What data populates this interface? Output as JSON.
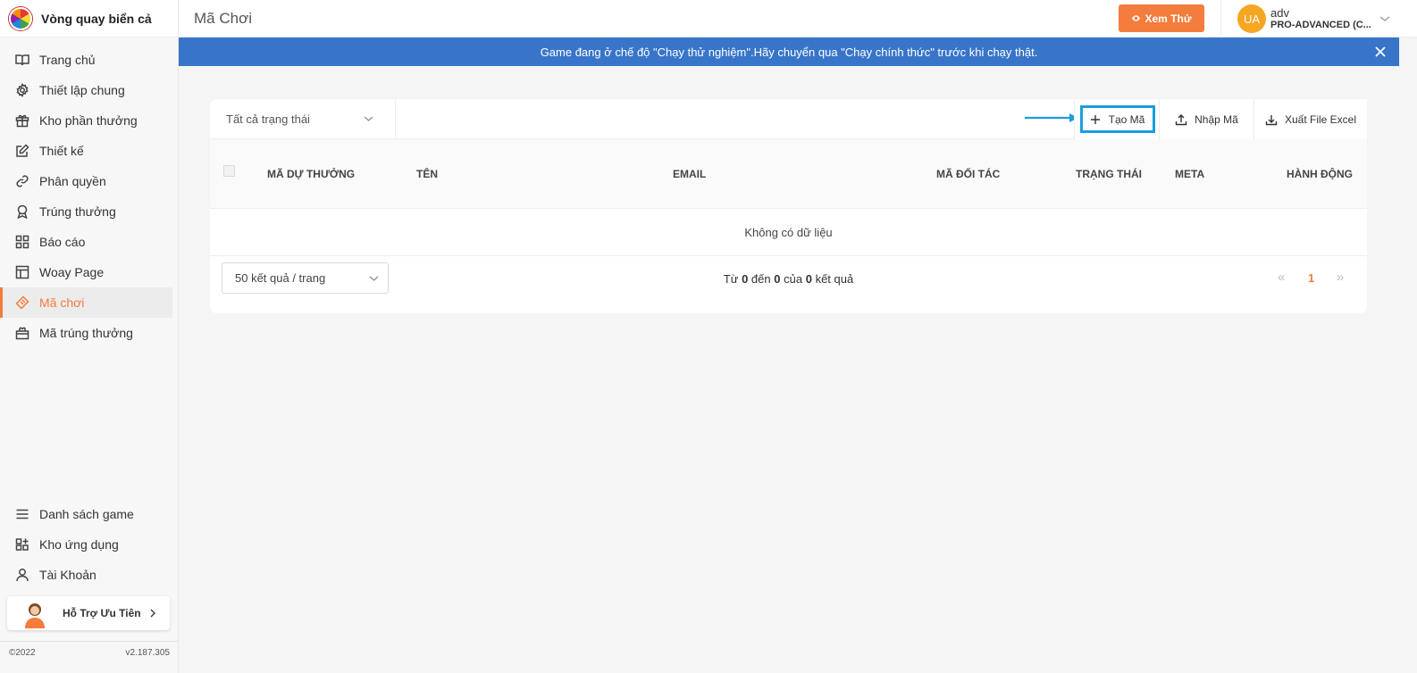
{
  "app": {
    "name": "Vòng quay biển cả",
    "copyright": "©2022",
    "version": "v2.187.305"
  },
  "sidebar": {
    "items": [
      {
        "label": "Trang chủ",
        "icon": "book-icon"
      },
      {
        "label": "Thiết lập chung",
        "icon": "gear-icon"
      },
      {
        "label": "Kho phần thưởng",
        "icon": "gift-icon"
      },
      {
        "label": "Thiết kế",
        "icon": "edit-icon"
      },
      {
        "label": "Phân quyền",
        "icon": "link-icon"
      },
      {
        "label": "Trúng thưởng",
        "icon": "award-icon"
      },
      {
        "label": "Báo cáo",
        "icon": "grid-icon"
      },
      {
        "label": "Woay Page",
        "icon": "layout-icon"
      },
      {
        "label": "Mã chơi",
        "icon": "ticket-icon",
        "active": true
      },
      {
        "label": "Mã trúng thưởng",
        "icon": "gift-box-icon"
      }
    ],
    "bottom_items": [
      {
        "label": "Danh sách game",
        "icon": "menu-icon"
      },
      {
        "label": "Kho ứng dụng",
        "icon": "apps-icon"
      },
      {
        "label": "Tài Khoản",
        "icon": "user-icon"
      }
    ],
    "support_label": "Hỗ Trợ Ưu Tiên"
  },
  "header": {
    "title": "Mã Chơi",
    "preview_label": "Xem Thử",
    "user": {
      "initials": "UA",
      "name": "adv",
      "plan": "PRO-ADVANCED (C..."
    }
  },
  "banner": {
    "text": "Game đang ở chế độ \"Chạy thử nghiệm\".Hãy chuyển qua \"Chạy chính thức\" trước khi chạy thật."
  },
  "toolbar": {
    "status_filter": "Tất cả trạng thái",
    "create_label": "Tạo Mã",
    "import_label": "Nhập Mã",
    "export_label": "Xuất File Excel"
  },
  "table": {
    "columns": [
      "MÃ DỰ THƯỞNG",
      "TÊN",
      "EMAIL",
      "MÃ ĐỐI TÁC",
      "TRẠNG THÁI",
      "META",
      "HÀNH ĐỘNG"
    ],
    "empty_text": "Không có dữ liệu"
  },
  "pagination": {
    "page_size": "50 kết quả / trang",
    "summary_prefix": "Từ",
    "from": "0",
    "summary_mid1": "đến",
    "to": "0",
    "summary_mid2": "của",
    "total": "0",
    "summary_suffix": "kết quả",
    "prev": "«",
    "current": "1",
    "next": "»"
  },
  "colors": {
    "accent": "#f47c3c",
    "banner": "#3875c9",
    "highlight": "#1a9de0"
  }
}
